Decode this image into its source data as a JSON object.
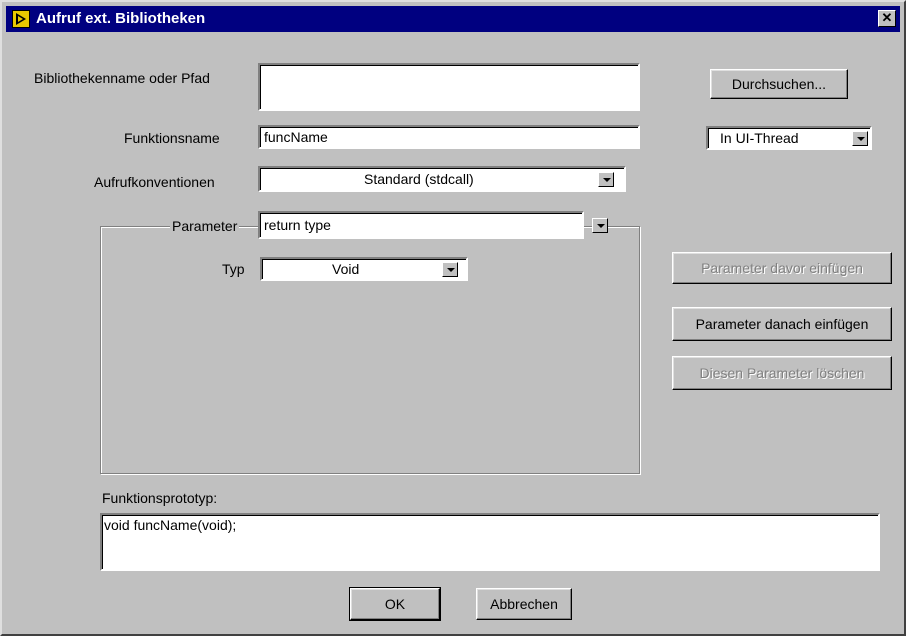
{
  "window": {
    "title": "Aufruf ext. Bibliotheken",
    "close_glyph": "✕"
  },
  "library": {
    "label": "Bibliothekenname oder Pfad",
    "value": ""
  },
  "browse_button": "Durchsuchen...",
  "function": {
    "label": "Funktionsname",
    "value": "funcName"
  },
  "thread": {
    "value": "In UI-Thread"
  },
  "calling_convention": {
    "label": "Aufrufkonventionen",
    "value": "Standard (stdcall)"
  },
  "parameter": {
    "label": "Parameter",
    "value": "return type"
  },
  "type": {
    "label": "Typ",
    "value": "Void"
  },
  "param_buttons": {
    "insert_before": "Parameter davor einfügen",
    "insert_after": "Parameter danach einfügen",
    "delete": "Diesen Parameter löschen"
  },
  "prototype": {
    "label": "Funktionsprototyp:",
    "value": "void funcName(void);"
  },
  "ok_button": "OK",
  "cancel_button": "Abbrechen",
  "icons": {
    "app": "labview-icon",
    "dropdown": "chevron-down-icon"
  }
}
